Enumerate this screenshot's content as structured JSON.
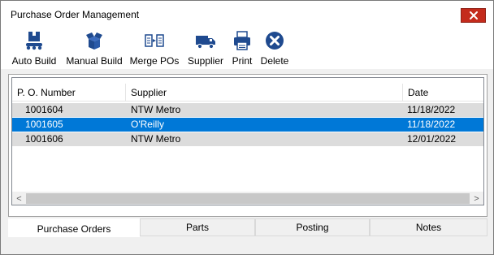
{
  "window": {
    "title": "Purchase Order Management"
  },
  "toolbar": {
    "buttons": [
      {
        "label": "Auto Build",
        "icon": "conveyor-box-icon"
      },
      {
        "label": "Manual Build",
        "icon": "open-box-icon"
      },
      {
        "label": "Merge POs",
        "icon": "merge-documents-icon"
      },
      {
        "label": "Supplier",
        "icon": "truck-icon"
      },
      {
        "label": "Print",
        "icon": "printer-icon"
      },
      {
        "label": "Delete",
        "icon": "delete-x-icon"
      }
    ]
  },
  "list": {
    "columns": [
      "P. O. Number",
      "Supplier",
      "Date"
    ],
    "rows": [
      {
        "po": "1001604",
        "supplier": "NTW Metro",
        "date": "11/18/2022",
        "selected": false
      },
      {
        "po": "1001605",
        "supplier": "O'Reilly",
        "date": "11/18/2022",
        "selected": true
      },
      {
        "po": "1001606",
        "supplier": "NTW Metro",
        "date": "12/01/2022",
        "selected": false
      }
    ],
    "scroll_left": "<",
    "scroll_right": ">"
  },
  "tabs": {
    "items": [
      "Purchase Orders",
      "Parts",
      "Posting",
      "Notes"
    ],
    "active": "Purchase Orders"
  },
  "colors": {
    "selection": "#0078d7",
    "row_bg": "#dcdcdc",
    "close_button": "#c42b1c",
    "icon_blue": "#1f4a8f"
  }
}
